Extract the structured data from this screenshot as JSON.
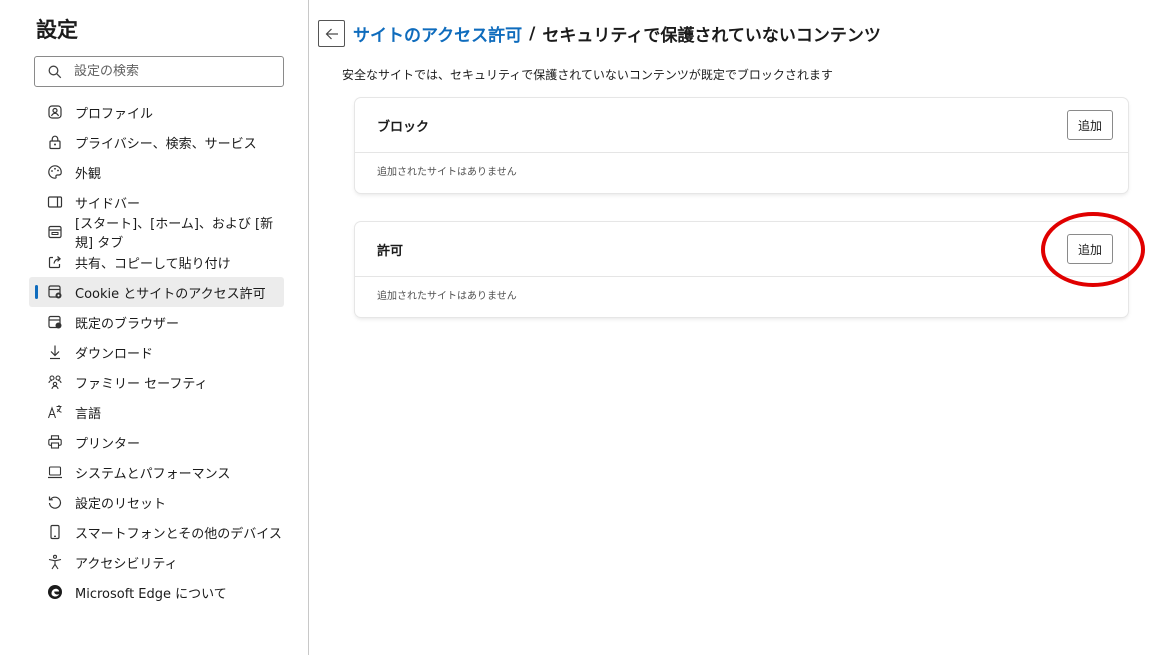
{
  "sidebar": {
    "title": "設定",
    "search_placeholder": "設定の検索",
    "items": [
      {
        "label": "プロファイル",
        "icon": "profile-icon"
      },
      {
        "label": "プライバシー、検索、サービス",
        "icon": "lock-icon"
      },
      {
        "label": "外観",
        "icon": "appearance-icon"
      },
      {
        "label": "サイドバー",
        "icon": "sidebar-icon"
      },
      {
        "label": "[スタート]、[ホーム]、および [新規] タブ",
        "icon": "home-tab-icon"
      },
      {
        "label": "共有、コピーして貼り付け",
        "icon": "share-icon"
      },
      {
        "label": "Cookie とサイトのアクセス許可",
        "icon": "cookie-permissions-icon",
        "active": true
      },
      {
        "label": "既定のブラウザー",
        "icon": "default-browser-icon"
      },
      {
        "label": "ダウンロード",
        "icon": "download-icon"
      },
      {
        "label": "ファミリー セーフティ",
        "icon": "family-icon"
      },
      {
        "label": "言語",
        "icon": "language-icon"
      },
      {
        "label": "プリンター",
        "icon": "printer-icon"
      },
      {
        "label": "システムとパフォーマンス",
        "icon": "system-icon"
      },
      {
        "label": "設定のリセット",
        "icon": "reset-icon"
      },
      {
        "label": "スマートフォンとその他のデバイス",
        "icon": "phone-icon"
      },
      {
        "label": "アクセシビリティ",
        "icon": "accessibility-icon"
      },
      {
        "label": "Microsoft Edge について",
        "icon": "edge-logo-icon"
      }
    ]
  },
  "main": {
    "breadcrumb_link": "サイトのアクセス許可",
    "breadcrumb_sep": "/",
    "breadcrumb_current": "セキュリティで保護されていないコンテンツ",
    "description": "安全なサイトでは、セキュリティで保護されていないコンテンツが既定でブロックされます",
    "block_card": {
      "title": "ブロック",
      "add_label": "追加",
      "empty_text": "追加されたサイトはありません"
    },
    "allow_card": {
      "title": "許可",
      "add_label": "追加",
      "empty_text": "追加されたサイトはありません"
    }
  },
  "colors": {
    "accent": "#0f6cbd",
    "highlight": "#e00000"
  }
}
